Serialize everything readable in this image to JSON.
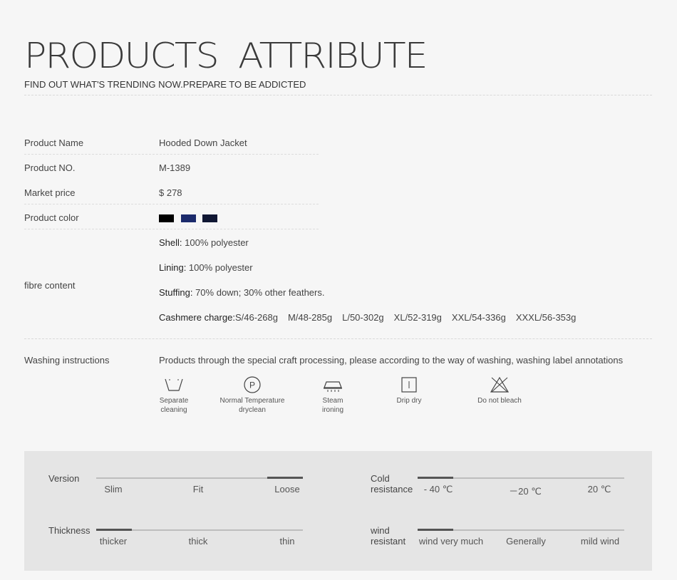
{
  "header": {
    "title": "PRODUCTS  ATTRIBUTE",
    "subtitle": "FIND OUT WHAT'S TRENDING NOW.PREPARE TO BE ADDICTED"
  },
  "product": {
    "name_label": "Product  Name",
    "name_value": "Hooded  Down Jacket",
    "no_label": "Product NO.",
    "no_value": "M-1389",
    "price_label": "Market price",
    "price_value": "$ 278",
    "color_label": "Product color",
    "colors": [
      "#000000",
      "#1b2a6b",
      "#101733"
    ]
  },
  "fibre": {
    "label": "fibre content",
    "shell_key": "Shell:",
    "shell_val": " 100% polyester",
    "lining_key": "Lining:",
    "lining_val": " 100% polyester",
    "stuffing_key": "Stuffing:",
    "stuffing_val": " 70% down; 30% other feathers.",
    "cash_key": "Cashmere charge:",
    "cash_sizes": [
      "S/46-268g",
      "M/48-285g",
      "L/50-302g",
      "XL/52-319g",
      "XXL/54-336g",
      "XXXL/56-353g"
    ]
  },
  "washing": {
    "label": "Washing instructions",
    "description": "Products through the special craft processing, please according to the way of washing, washing label annotations",
    "icons": [
      {
        "icon": "wash-tub-icon",
        "line1": "Separate",
        "line2": "cleaning"
      },
      {
        "icon": "dryclean-p-icon",
        "line1": "Normal Temperature",
        "line2": "dryclean"
      },
      {
        "icon": "steam-iron-icon",
        "line1": "Steam",
        "line2": "ironing"
      },
      {
        "icon": "drip-dry-icon",
        "line1": "Drip dry",
        "line2": ""
      },
      {
        "icon": "no-bleach-icon",
        "line1": "Do not bleach",
        "line2": ""
      }
    ]
  },
  "attributes": {
    "version": {
      "label": "Version",
      "ticks": [
        "Slim",
        "Fit",
        "Loose"
      ],
      "selected": "Loose"
    },
    "thickness": {
      "label": "Thickness",
      "ticks": [
        "thicker",
        "thick",
        "thin"
      ],
      "selected": "thicker"
    },
    "cold": {
      "label1": "Cold",
      "label2": "resistance",
      "ticks": [
        "- 40 ℃",
        "－20 ℃",
        "20 ℃"
      ],
      "selected": "- 40 ℃"
    },
    "wind": {
      "label1": "wind",
      "label2": "resistant",
      "ticks": [
        "wind very much",
        "Generally",
        "mild wind"
      ],
      "selected": "wind very much"
    }
  }
}
